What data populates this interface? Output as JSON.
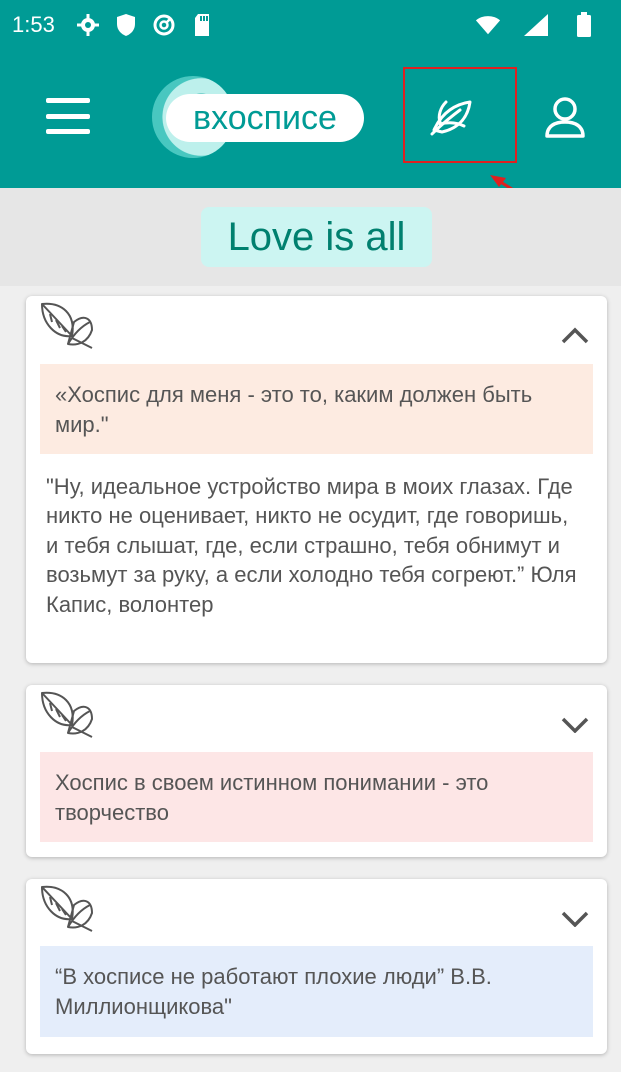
{
  "status_bar": {
    "time": "1:53"
  },
  "app_bar": {
    "logo_text": "вхосписе"
  },
  "banner": {
    "title": "Love is all"
  },
  "cards": [
    {
      "quote": "«Хоспис для меня - это то, каким должен быть мир.\"",
      "quote_color": "#fdebe1",
      "expanded": true,
      "body": "\"Ну, идеальное устройство мира в моих глазах. Где никто не оценивает, никто не осудит, где говоришь, и тебя слышат, где, если страшно, тебя обнимут и возьмут за руку, а если холодно тебя согреют.” Юля Капис, волонтер"
    },
    {
      "quote": "Хоспис в своем истинном понимании - это творчество",
      "quote_color": "#fde6e6",
      "expanded": false
    },
    {
      "quote": "“В хосписе не работают плохие люди” В.В. Миллионщикова\"",
      "quote_color": "#e4edfb",
      "expanded": false
    }
  ],
  "colors": {
    "primary": "#009b95",
    "accent_text": "#00806f",
    "highlight": "#e02020"
  }
}
